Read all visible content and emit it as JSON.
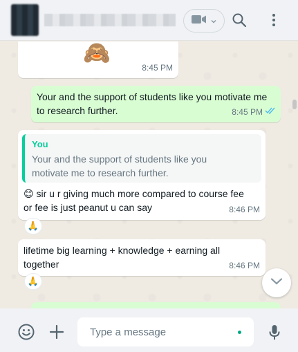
{
  "header": {
    "contact_name": "",
    "icons": [
      "video-call-icon",
      "chevron-down-icon",
      "search-icon",
      "menu-icon"
    ]
  },
  "messages": [
    {
      "id": "m1",
      "direction": "incoming",
      "emoji": "🙈",
      "time": "8:45 PM"
    },
    {
      "id": "m2",
      "direction": "outgoing",
      "text_line1": "Your and the support of students like you motivate me",
      "text_line2": "to research further.",
      "time": "8:45 PM",
      "status": "read"
    },
    {
      "id": "m3",
      "direction": "incoming",
      "quote_sender": "You",
      "quote_line1": "Your and the support of students like you",
      "quote_line2": "motivate me to research further.",
      "emoji": "😊",
      "text_line1": " sir u r giving much more compared to course fee",
      "text_line2": "or fee is just peanut u can say",
      "time": "8:46 PM",
      "reaction": "🙏"
    },
    {
      "id": "m4",
      "direction": "incoming",
      "text_line1": "lifetime big learning + knowledge + earning all",
      "text_line2": "together",
      "time": "8:46 PM",
      "reaction": "🙏"
    }
  ],
  "footer": {
    "placeholder": "Type a message",
    "icons": [
      "emoji-icon",
      "attach-plus-icon",
      "microphone-icon"
    ]
  },
  "colors": {
    "chat_bg": "#efeae2",
    "outgoing_bubble": "#d9fdd3",
    "incoming_bubble": "#ffffff",
    "accent": "#00a884",
    "read_ticks": "#53bdeb",
    "quote_sender": "#06cf9c"
  }
}
